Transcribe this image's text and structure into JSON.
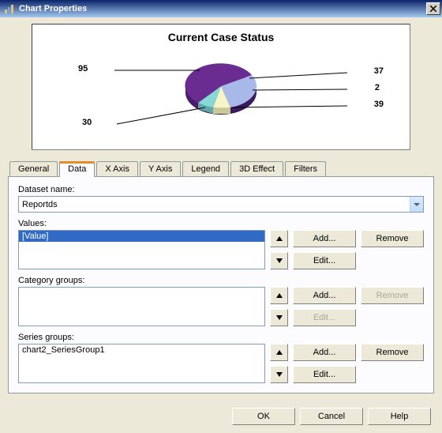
{
  "window": {
    "title": "Chart Properties"
  },
  "chart_data": {
    "type": "pie",
    "title": "Current Case Status",
    "slices": [
      {
        "label": "95",
        "value": 95
      },
      {
        "label": "37",
        "value": 37
      },
      {
        "label": "2",
        "value": 2
      },
      {
        "label": "39",
        "value": 39
      },
      {
        "label": "30",
        "value": 30
      }
    ]
  },
  "tabs": {
    "general": "General",
    "data": "Data",
    "xaxis": "X Axis",
    "yaxis": "Y Axis",
    "legend": "Legend",
    "effect3d": "3D Effect",
    "filters": "Filters",
    "active": "Data"
  },
  "dataset": {
    "label": "Dataset name:",
    "value": "Reportds"
  },
  "values": {
    "label": "Values:",
    "items": [
      "[Value]"
    ],
    "add": "Add...",
    "edit": "Edit...",
    "remove": "Remove"
  },
  "category": {
    "label": "Category groups:",
    "items": [],
    "add": "Add...",
    "edit": "Edit...",
    "remove": "Remove"
  },
  "series": {
    "label": "Series groups:",
    "items": [
      "chart2_SeriesGroup1"
    ],
    "add": "Add...",
    "edit": "Edit...",
    "remove": "Remove"
  },
  "buttons": {
    "ok": "OK",
    "cancel": "Cancel",
    "help": "Help"
  }
}
